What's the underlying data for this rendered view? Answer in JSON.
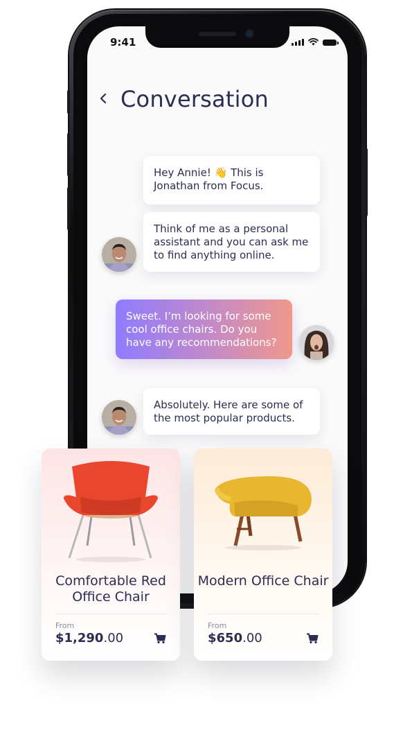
{
  "status_bar": {
    "time": "9:41"
  },
  "header": {
    "back_icon": "chevron-left-icon",
    "title": "Conversation"
  },
  "messages": [
    {
      "sender": "Jonathan",
      "text_before_emoji": "Hey Annie! ",
      "emoji": "👋",
      "text_after_emoji": " This is Jonathan from Focus."
    },
    {
      "sender": "Jonathan",
      "text": "Think of me as a personal assistant and you can ask me to find anything online."
    },
    {
      "sender": "Annie",
      "text": "Sweet. I’m looking for some cool office chairs. Do you have any recommendations?"
    },
    {
      "sender": "Jonathan",
      "text": "Absolutely. Here are some of the most popular products."
    }
  ],
  "products": [
    {
      "name": "Comfortable Red Office Chair",
      "from_label": "From",
      "price_whole": "$1,290",
      "price_cents": ".00",
      "cart_icon": "cart-icon",
      "accent": "#e8472e"
    },
    {
      "name": "Modern Office Chair",
      "from_label": "From",
      "price_whole": "$650",
      "price_cents": ".00",
      "cart_icon": "cart-icon",
      "accent": "#e9b62f"
    }
  ],
  "colors": {
    "text": "#2b2d52",
    "bubble_gradient_start": "#8e7cff",
    "bubble_gradient_end": "#f0988a"
  }
}
